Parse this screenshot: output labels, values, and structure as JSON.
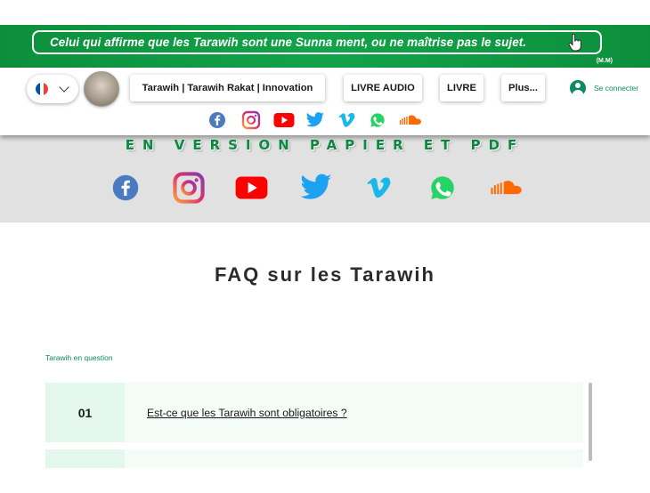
{
  "banner": {
    "quote": "Celui qui affirme que les Tarawih sont une Sunna ment, ou ne maîtrise pas le sujet.",
    "signature": "(M.M)"
  },
  "header": {
    "language": {
      "selected": "fr",
      "flag_colors": [
        "#0055a4",
        "#ffffff",
        "#ef4135"
      ]
    },
    "nav": [
      {
        "label": "Tarawih | Tarawih Rakat | Innovation"
      },
      {
        "label": "LIVRE AUDIO"
      },
      {
        "label": "LIVRE"
      },
      {
        "label": "Plus..."
      }
    ],
    "login_label": "Se connecter",
    "social_icons": [
      "facebook-icon",
      "instagram-icon",
      "youtube-icon",
      "twitter-icon",
      "vimeo-icon",
      "whatsapp-icon",
      "soundcloud-icon"
    ]
  },
  "band": {
    "title": "EN VERSION PAPIER ET PDF"
  },
  "main": {
    "title": "FAQ sur les Tarawih",
    "section_label": "Tarawih en question",
    "faq": [
      {
        "number": "01",
        "question": "Est-ce que les Tarawih sont obligatoires ?"
      },
      {
        "number": "",
        "question": ""
      }
    ]
  },
  "colors": {
    "brand_green": "#12a34a",
    "accent_teal": "#0b8a63",
    "facebook": "#4a7bc0",
    "youtube": "#ff0000",
    "twitter": "#1da1f2",
    "vimeo": "#1ab7ea",
    "whatsapp": "#25d366",
    "soundcloud": "#ff6a00"
  }
}
